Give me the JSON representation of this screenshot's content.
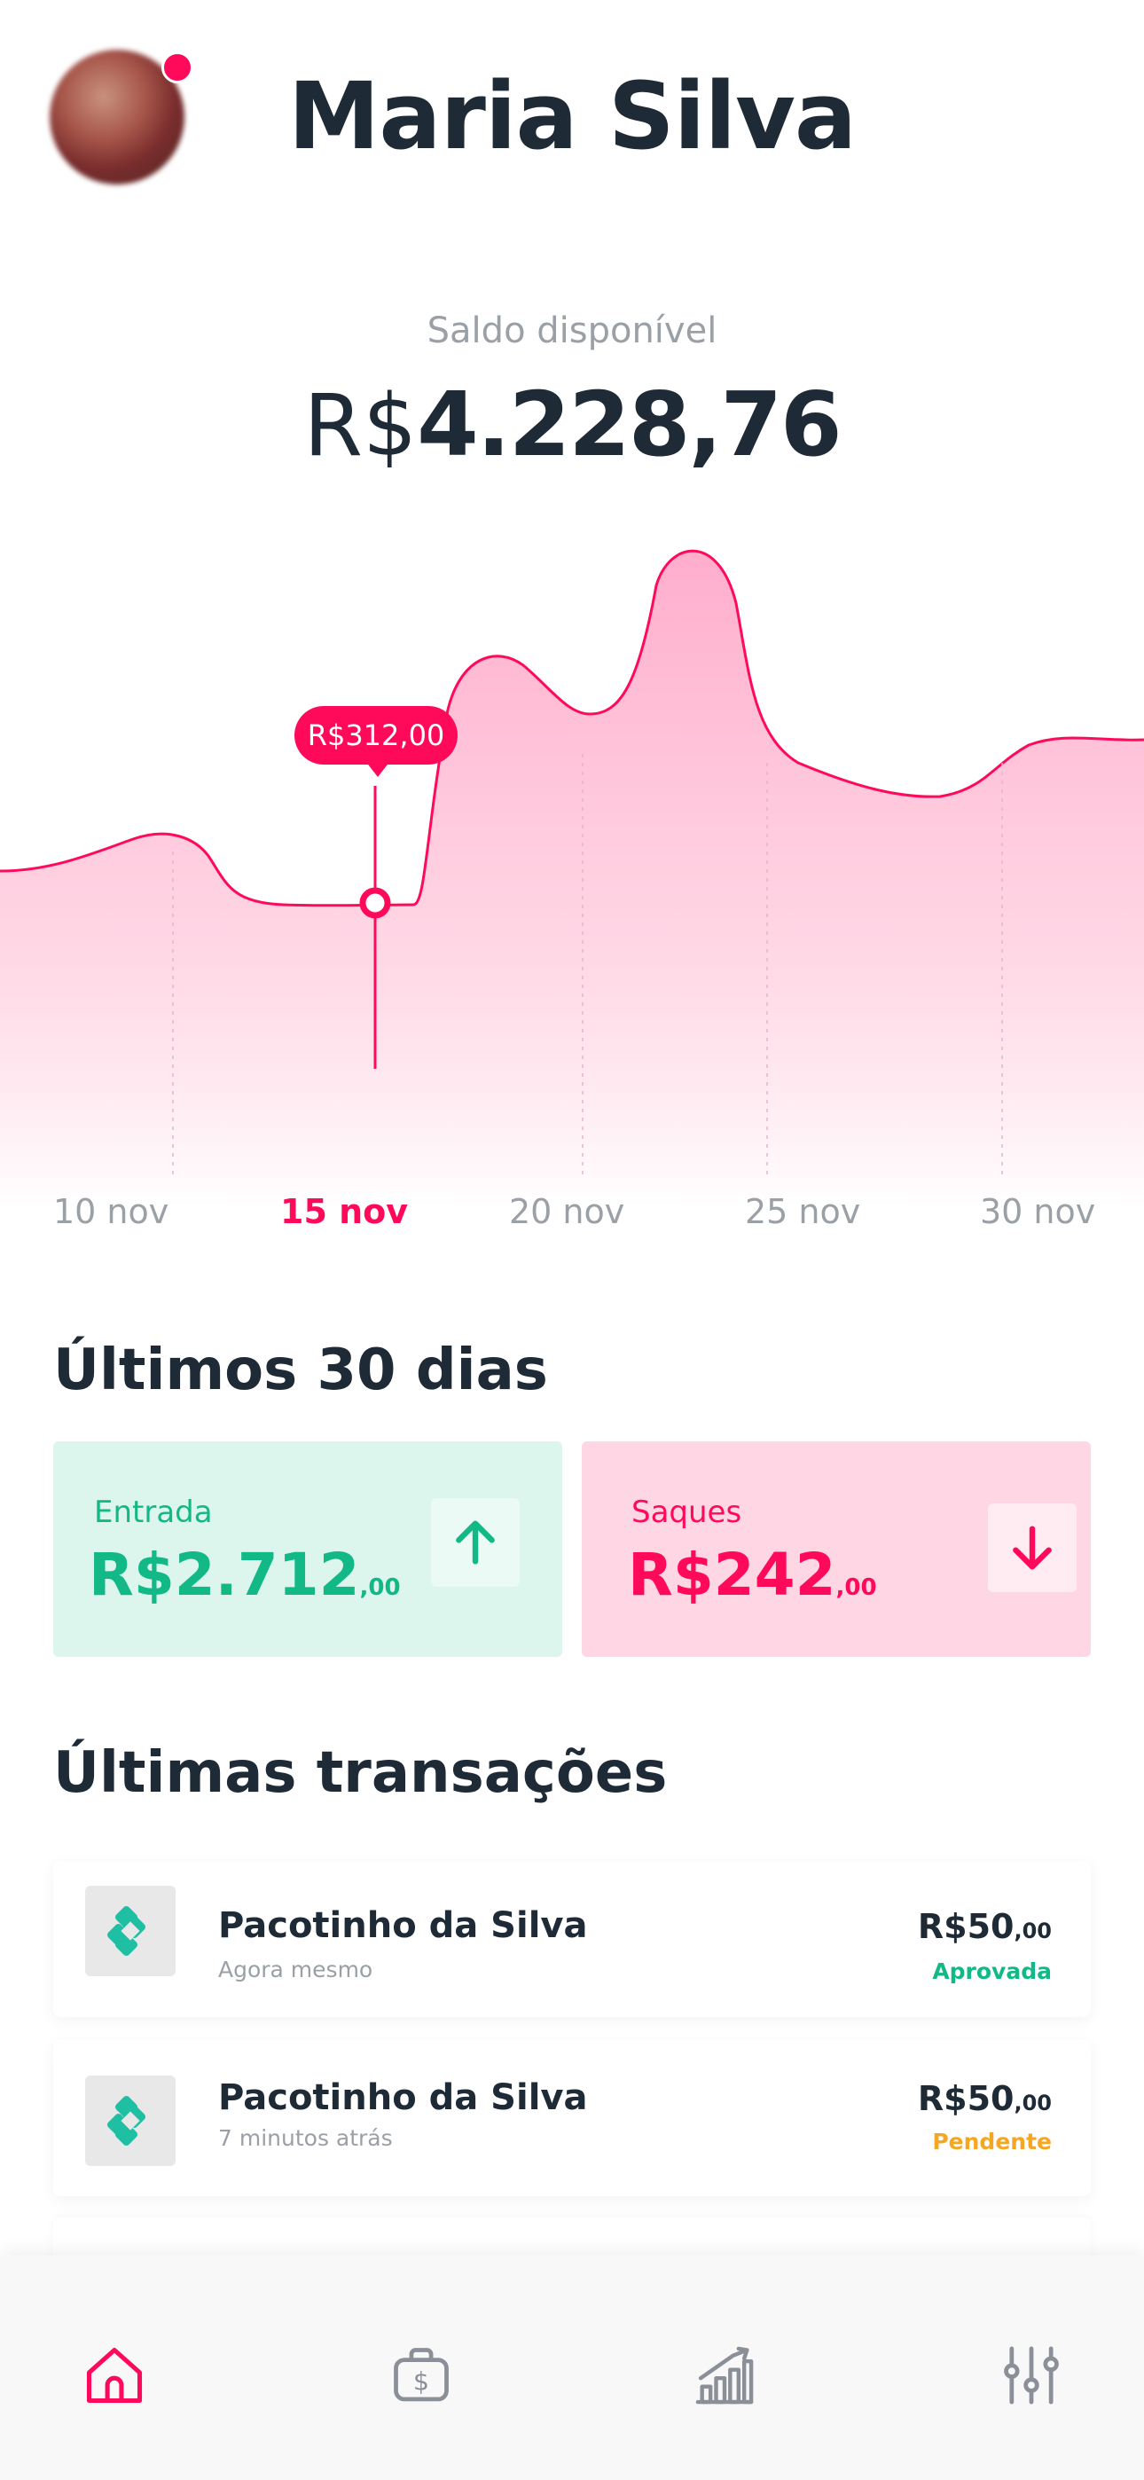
{
  "header": {
    "user_name": "Maria Silva"
  },
  "balance": {
    "label": "Saldo disponível",
    "currency": "R$",
    "amount": "4.228,76"
  },
  "chart_data": {
    "type": "area",
    "x": [
      "10 nov",
      "15 nov",
      "20 nov",
      "25 nov",
      "30 nov"
    ],
    "selected_x": "15 nov",
    "tooltip": "R$312,00",
    "colors": {
      "line": "#ff0a5a",
      "fill": "#ffb3cf"
    }
  },
  "summary": {
    "title": "Últimos 30 dias",
    "income": {
      "label": "Entrada",
      "currency": "R$",
      "amount": "2.712",
      "cents": ",00",
      "color": "#12b886",
      "icon": "arrow-up-icon"
    },
    "withdrawals": {
      "label": "Saques",
      "currency": "R$",
      "amount": "242",
      "cents": ",00",
      "color": "#ff0a5a",
      "icon": "arrow-down-icon"
    }
  },
  "transactions": {
    "title": "Últimas transações",
    "items": [
      {
        "name": "Pacotinho da Silva",
        "time": "Agora mesmo",
        "currency": "R$",
        "amount": "50",
        "cents": ",00",
        "status": "Aprovada",
        "status_color": "#12b886",
        "icon": "pix-icon"
      },
      {
        "name": "Pacotinho da Silva",
        "time": "7 minutos atrás",
        "currency": "R$",
        "amount": "50",
        "cents": ",00",
        "status": "Pendente",
        "status_color": "#f5a623",
        "icon": "pix-icon"
      }
    ]
  },
  "nav": {
    "items": [
      {
        "icon": "home-icon",
        "active": true
      },
      {
        "icon": "wallet-icon",
        "active": false
      },
      {
        "icon": "chart-icon",
        "active": false
      },
      {
        "icon": "settings-sliders-icon",
        "active": false
      }
    ],
    "active_color": "#ff0a5a",
    "inactive_color": "#8a8f98"
  }
}
